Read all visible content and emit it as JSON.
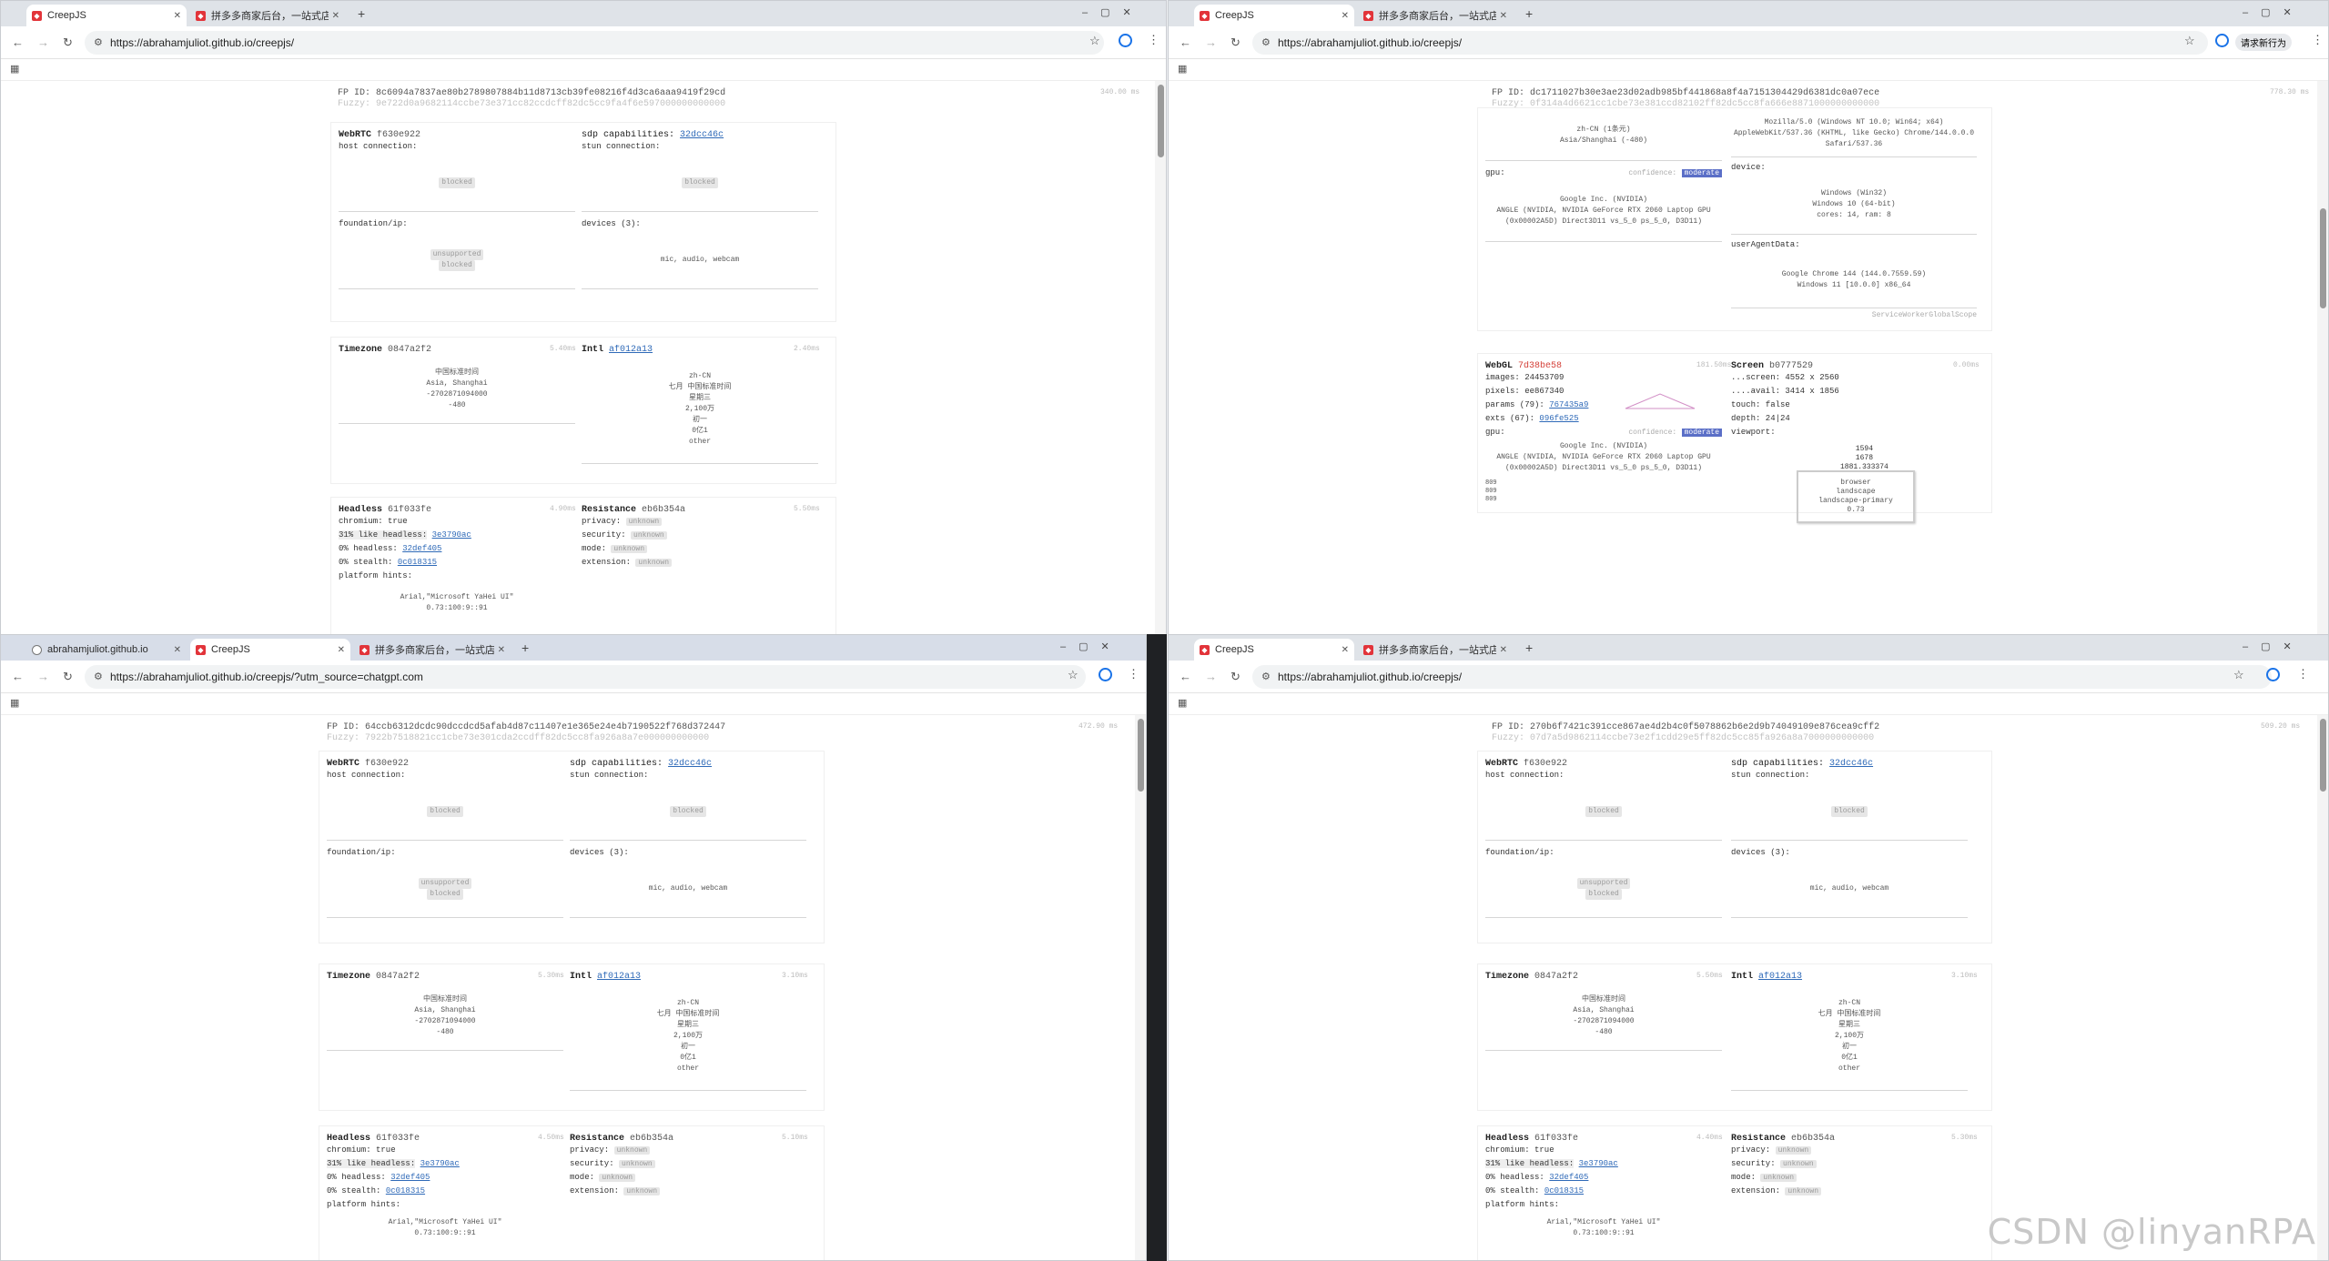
{
  "win1": {
    "tabs": [
      {
        "label": "CreepJS",
        "icon": "creepjs-favicon"
      },
      {
        "label": "拼多多商家后台，一站式店铺管..."
      }
    ],
    "url": "https://abrahamjuliot.github.io/creepjs/",
    "fp_id": "FP ID: 8c6094a7837ae80b2789807884b11d8713cb39fe08216f4d3ca6aaa9419f29cd",
    "fuzzy": "Fuzzy: 9e722d0a9682114ccbe73e371cc82ccdcff82dc5cc9fa4f6e597000000000000",
    "timing": "340.00 ms",
    "webrtc": {
      "title": "WebRTC",
      "hash": "f630e922",
      "host_label": "host connection:",
      "host_val": "blocked",
      "sdp_label": "sdp capabilities:",
      "sdp_hash": "32dcc46c",
      "stun_label": "stun connection:",
      "stun_val": "blocked",
      "found_label": "foundation/ip:",
      "found_1": "unsupported",
      "found_2": "blocked",
      "devices_label": "devices (3):",
      "devices_val": "mic, audio, webcam"
    },
    "timezone": {
      "title": "Timezone",
      "hash": "0847a2f2",
      "timing": "5.40ms",
      "lines": [
        "中国标准时间",
        "Asia, Shanghai",
        "-2702871094000",
        "-480"
      ]
    },
    "intl": {
      "title": "Intl",
      "hash": "af012a13",
      "timing": "2.40ms",
      "lines": [
        "zh-CN",
        "七月 中国标准时间",
        "星期三",
        "2,100万",
        "初一",
        "0亿1",
        "other"
      ]
    },
    "headless": {
      "title": "Headless",
      "hash": "61f033fe",
      "timing": "4.90ms",
      "chromium": "chromium: true",
      "like": "31% like headless:",
      "like_hash": "3e3790ac",
      "h0": "0% headless:",
      "h0_hash": "32def405",
      "stealth": "0% stealth:",
      "stealth_hash": "0c018315",
      "hints": "platform hints:",
      "fonts": "Arial,\"Microsoft YaHei UI\"",
      "fonts2": "0.73:100:9::91"
    },
    "resistance": {
      "title": "Resistance",
      "hash": "eb6b354a",
      "timing": "5.50ms",
      "privacy": "privacy:",
      "security": "security:",
      "mode": "mode:",
      "extension": "extension:",
      "unknown": "unknown"
    }
  },
  "win2": {
    "tabs": [
      {
        "label": "CreepJS"
      },
      {
        "label": "拼多多商家后台，一站式店铺管..."
      }
    ],
    "url": "https://abrahamjuliot.github.io/creepjs/",
    "update_btn": "请求新行为",
    "fp_id": "FP ID: dc1711027b30e3ae23d02adb985bf441868a8f4a7151304429d6381dc0a07ece",
    "fuzzy": "Fuzzy: 0f314a4d6621cc1cbe73e381ccd82102ff82dc5cc8fa666e8871000000000000",
    "timing": "778.30 ms",
    "nav_top": [
      "zh-CN (1条元)",
      "Asia/Shanghai (-480)"
    ],
    "ua_lines": [
      "Mozilla/5.0 (Windows NT 10.0; Win64; x64)",
      "AppleWebKit/537.36 (KHTML, like Gecko) Chrome/144.0.0.0",
      "Safari/537.36"
    ],
    "gpu_label": "gpu:",
    "confidence": "confidence:",
    "moderate": "moderate",
    "gpu_lines": [
      "Google Inc. (NVIDIA)",
      "ANGLE (NVIDIA, NVIDIA GeForce RTX 2060 Laptop GPU",
      "(0x00002A5D) Direct3D11 vs_5_0 ps_5_0, D3D11)"
    ],
    "device_label": "device:",
    "device_lines": [
      "Windows (Win32)",
      "Windows 10 (64-bit)",
      "cores: 14, ram: 8"
    ],
    "uad_label": "userAgentData:",
    "uad_lines": [
      "Google Chrome 144 (144.0.7559.59)",
      "Windows 11 [10.0.0] x86_64"
    ],
    "worker_scope": "ServiceWorkerGlobalScope",
    "webgl": {
      "title": "WebGL",
      "hash": "7d38be58",
      "timing": "181.50ms",
      "images": "images: 24453709",
      "pixels": "pixels: ee867340",
      "params": "params (79):",
      "params_hash": "767435a9",
      "exts": "exts (67):",
      "exts_hash": "096fe525"
    },
    "screen": {
      "title": "Screen",
      "hash": "b0777529",
      "timing": "0.00ms",
      "screen": "...screen: 4552 x 2560",
      "avail": "....avail: 3414 x 1856",
      "touch": "touch: false",
      "depth": "depth: 24|24",
      "viewport": "viewport:",
      "vp_lines": [
        "1594",
        "1678",
        "1881.333374"
      ],
      "small": [
        "809",
        "809",
        "809"
      ],
      "box_lines": [
        "browser",
        "landscape",
        "landscape-primary",
        "0.73"
      ]
    }
  },
  "win3": {
    "tabs": [
      {
        "label": "abrahamjuliot.github.io"
      },
      {
        "label": "CreepJS"
      },
      {
        "label": "拼多多商家后台，一站式店铺管..."
      }
    ],
    "url": "https://abrahamjuliot.github.io/creepjs/?utm_source=chatgpt.com",
    "fp_id": "FP ID: 64ccb6312dcdc90dccdcd5afab4d87c11407e1e365e24e4b7190522f768d372447",
    "fuzzy": "Fuzzy: 7922b7518821cc1cbe73e301cda2ccdff82dc5cc8fa926a8a7e000000000000",
    "timing": "472.90 ms",
    "tz_timing": "5.30ms",
    "intl_timing": "3.10ms",
    "hl_timing": "4.50ms",
    "res_timing": "5.10ms"
  },
  "win4": {
    "tabs": [
      {
        "label": "CreepJS"
      },
      {
        "label": "拼多多商家后台，一站式店铺管..."
      }
    ],
    "url": "https://abrahamjuliot.github.io/creepjs/",
    "fp_id": "FP ID: 270b6f7421c391cce867ae4d2b4c0f5078862b6e2d9b74049109e876cea9cff2",
    "fuzzy": "Fuzzy: 07d7a5d9862114ccbe73e2f1cdd29e5ff82dc5cc85fa926a8a7000000000000",
    "timing": "509.20 ms",
    "tz_timing": "5.50ms",
    "intl_timing": "3.10ms",
    "hl_timing": "4.40ms",
    "res_timing": "5.30ms"
  },
  "watermark": "CSDN @linyanRPA"
}
